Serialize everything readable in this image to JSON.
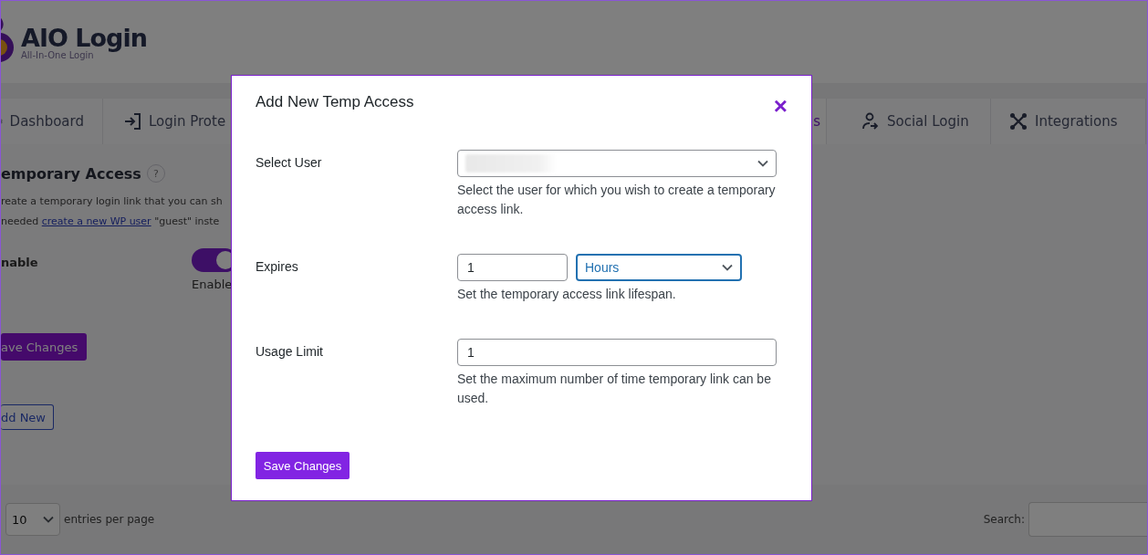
{
  "header": {
    "logo_title": "AIO Login",
    "logo_subtitle": "All-In-One Login"
  },
  "tabs": [
    {
      "label": "Dashboard",
      "selected": false
    },
    {
      "label": "Login Prote",
      "selected": false
    },
    {
      "label": "s",
      "selected": true
    },
    {
      "label": "Social Login",
      "selected": false
    },
    {
      "label": "Integrations",
      "selected": false
    }
  ],
  "section": {
    "title": "emporary Access",
    "help": "?",
    "description_line_1": "reate a temporary login link that you can sh",
    "description_before_link": "needed ",
    "description_link": "create a new WP user",
    "description_after_link": " \"guest\" inste"
  },
  "enable": {
    "label": "nable",
    "on": true,
    "caption": "Enable"
  },
  "save_button": "ave Changes",
  "add_new_button": "dd New",
  "entries": {
    "value": "10",
    "label": "entries per page"
  },
  "search": {
    "label": "Search:"
  },
  "modal": {
    "title": "Add New Temp Access",
    "close": "×",
    "save_button": "Save Changes",
    "fields": [
      {
        "kind": "select",
        "label": "Select User",
        "help": "Select the user for which you wish to create a temporary access link."
      },
      {
        "kind": "expires",
        "label": "Expires",
        "value": "1",
        "unit": "Hours",
        "help": "Set the temporary access link lifespan."
      },
      {
        "kind": "number",
        "label": "Usage Limit",
        "value": "1",
        "help": "Set the maximum number of time temporary link can be used."
      }
    ]
  }
}
